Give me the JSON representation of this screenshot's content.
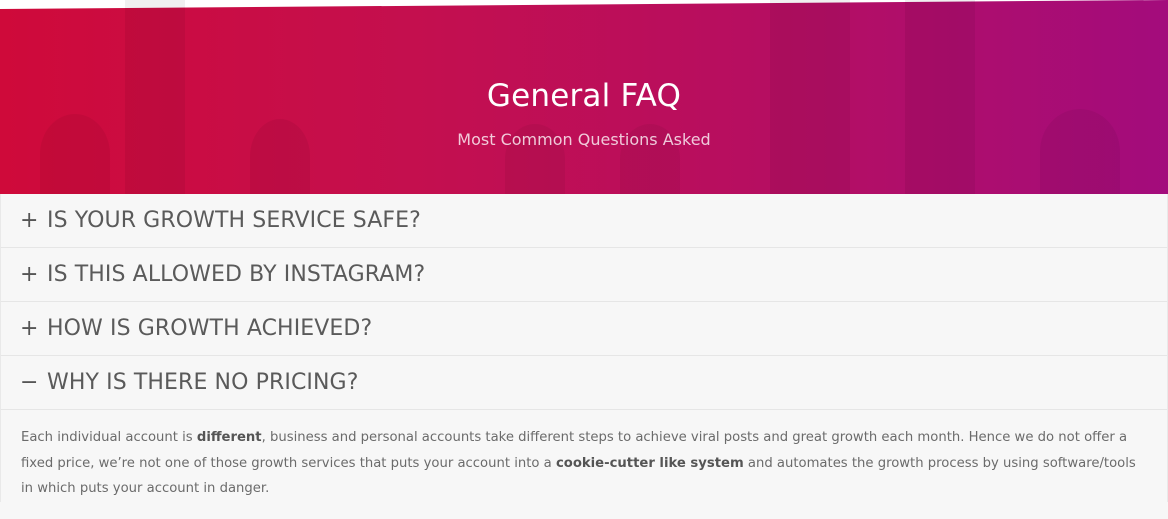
{
  "header": {
    "title": "General FAQ",
    "subtitle": "Most Common Questions Asked"
  },
  "faq": {
    "items": [
      {
        "question": "IS YOUR GROWTH SERVICE SAFE?",
        "toggle": "+",
        "expanded": false
      },
      {
        "question": "IS THIS ALLOWED BY INSTAGRAM?",
        "toggle": "+",
        "expanded": false
      },
      {
        "question": "HOW IS GROWTH ACHIEVED?",
        "toggle": "+",
        "expanded": false
      },
      {
        "question": "WHY IS THERE NO PRICING?",
        "toggle": "−",
        "expanded": true
      }
    ],
    "answer": {
      "part1": "Each individual account is ",
      "bold1": "different",
      "part2": ", business and personal accounts take different steps to achieve viral posts and great growth each month. Hence we do not offer a fixed price, we’re not one of those growth services that puts your account into a ",
      "bold2": "cookie-cutter like system",
      "part3": " and automates the growth process by using software/tools in which puts your account in danger."
    }
  },
  "colors": {
    "hero_start": "#cf0a3a",
    "hero_end": "#a30c7c",
    "text": "#5a5a5a"
  }
}
